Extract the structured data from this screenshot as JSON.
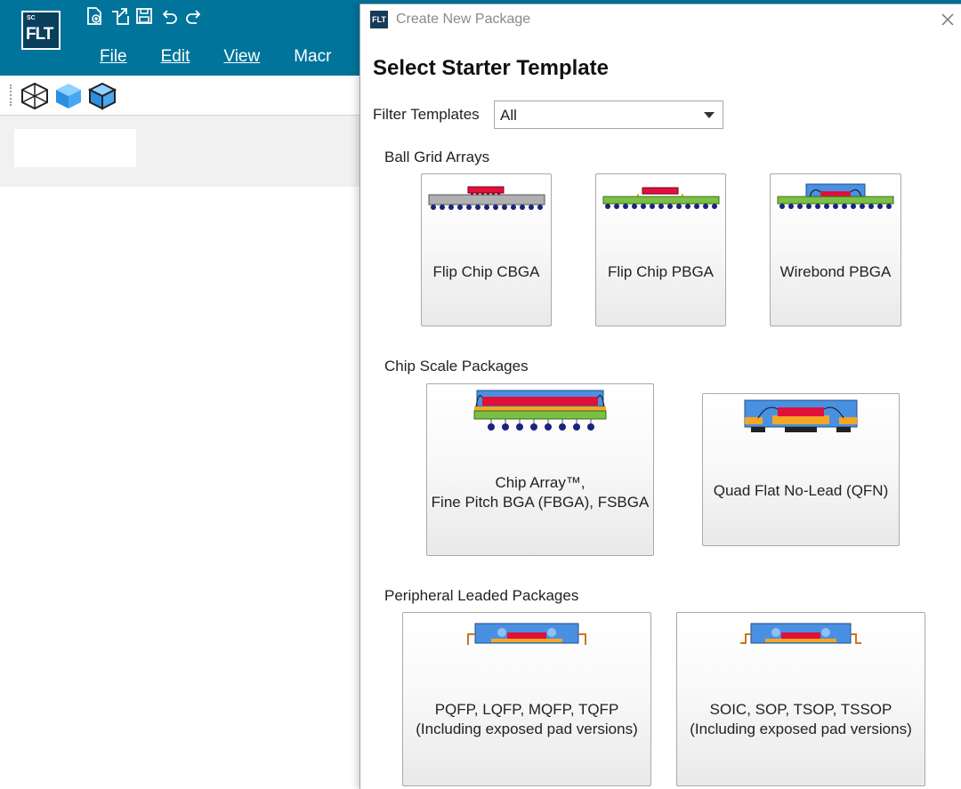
{
  "app": {
    "logo_top": "SC",
    "logo_main": "FLT",
    "menu": [
      {
        "label": "File"
      },
      {
        "label": "Edit"
      },
      {
        "label": "View"
      },
      {
        "label": "Macr"
      }
    ]
  },
  "dialog": {
    "title": "Create New Package",
    "icon_text": "FLT",
    "heading": "Select Starter Template",
    "filter": {
      "label": "Filter Templates",
      "value": "All"
    },
    "sections": [
      {
        "title": "Ball Grid Arrays",
        "templates": [
          {
            "label": "Flip Chip CBGA",
            "icon": "flip-chip-cbga-icon"
          },
          {
            "label": "Flip Chip PBGA",
            "icon": "flip-chip-pbga-icon"
          },
          {
            "label": "Wirebond PBGA",
            "icon": "wirebond-pbga-icon"
          }
        ]
      },
      {
        "title": "Chip Scale Packages",
        "templates": [
          {
            "label_line1": "Chip Array™,",
            "label_line2": "Fine Pitch BGA (FBGA), FSBGA",
            "icon": "chip-array-icon"
          },
          {
            "label": "Quad Flat No-Lead (QFN)",
            "icon": "qfn-icon"
          }
        ]
      },
      {
        "title": "Peripheral Leaded Packages",
        "templates": [
          {
            "label_line1": "PQFP, LQFP, MQFP, TQFP",
            "label_line2": "(Including exposed pad versions)",
            "icon": "pqfp-icon"
          },
          {
            "label_line1": "SOIC, SOP, TSOP, TSSOP",
            "label_line2": "(Including exposed pad versions)",
            "icon": "soic-icon"
          }
        ]
      }
    ]
  },
  "colors": {
    "header": "#00749b",
    "die": "#e0103a",
    "substrate_green": "#7ac143",
    "mold_blue": "#4a90e2",
    "ball": "#1a237e"
  }
}
